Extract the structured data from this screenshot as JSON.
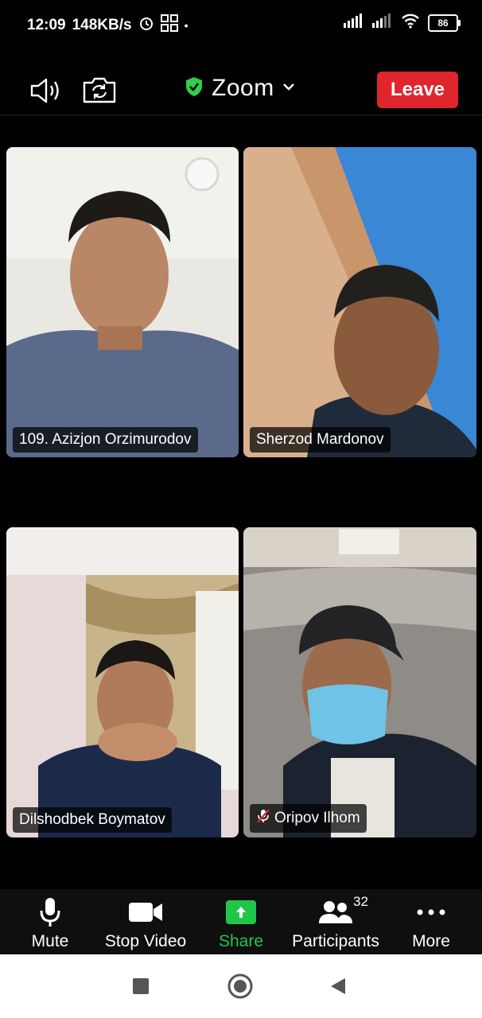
{
  "status_bar": {
    "time": "12:09",
    "speed": "148KB/s",
    "battery": "86",
    "icons": [
      "alarm-icon",
      "qr-icon",
      "signal-icon",
      "wifi-icon",
      "battery-icon"
    ]
  },
  "meeting_bar": {
    "title": "Zoom",
    "leave_label": "Leave",
    "icons": [
      "speaker-icon",
      "switch-camera-icon",
      "shield-check-icon",
      "chevron-down-icon"
    ],
    "colors": {
      "leave": "#e0252d",
      "shield": "#2fce4c"
    }
  },
  "participants": [
    {
      "name": "109. Azizjon Orzimurodov",
      "muted": false,
      "active": false
    },
    {
      "name": "Sherzod Mardonov",
      "muted": false,
      "active": true
    },
    {
      "name": "Dilshodbek Boymatov",
      "muted": false,
      "active": false
    },
    {
      "name": "Oripov Ilhom",
      "muted": true,
      "active": false
    }
  ],
  "toolbar": {
    "mute_label": "Mute",
    "stop_video_label": "Stop Video",
    "share_label": "Share",
    "participants_label": "Participants",
    "participants_count": "32",
    "more_label": "More",
    "colors": {
      "share": "#1fc64a"
    }
  },
  "nav": {
    "icons": [
      "recents-square-icon",
      "home-circle-icon",
      "back-triangle-icon"
    ]
  }
}
